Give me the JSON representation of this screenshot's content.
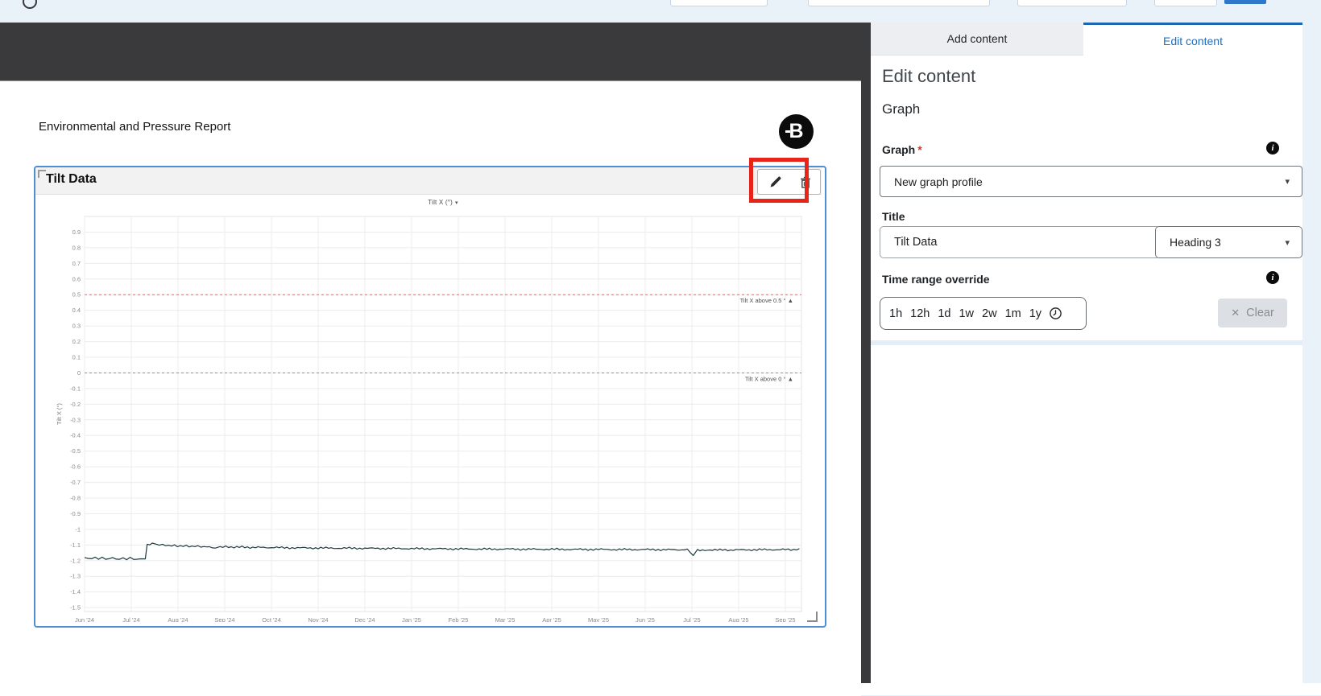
{
  "icons": {
    "info_glyph": "i",
    "caret": "▾",
    "clear_x": "✕",
    "chart_title_caret": "▾"
  },
  "document": {
    "report_title": "Environmental and Pressure Report",
    "logo_letter": "B",
    "graph_block_title": "Tilt Data"
  },
  "side_panel": {
    "tabs": [
      {
        "label": "Add content",
        "active": false
      },
      {
        "label": "Edit content",
        "active": true
      }
    ],
    "heading": "Edit content",
    "section": "Graph",
    "graph_field": {
      "label": "Graph",
      "required_mark": "*",
      "value": "New graph profile"
    },
    "title_field": {
      "label": "Title",
      "value": "Tilt Data",
      "style_value": "Heading 3"
    },
    "time_range": {
      "label": "Time range override",
      "options": [
        "1h",
        "12h",
        "1d",
        "1w",
        "2w",
        "1m",
        "1y"
      ],
      "clear_label": "Clear"
    }
  },
  "chart_data": {
    "type": "line",
    "title": "Tilt X (°)",
    "ylabel": "Tilt X (°)",
    "xlabel": "",
    "grid": true,
    "legend": "none",
    "ylim": [
      -1.525,
      1.0
    ],
    "x_months": [
      0,
      15
    ],
    "x_tick_labels": [
      "Jun '24",
      "Jul '24",
      "Aug '24",
      "Sep '24",
      "Oct '24",
      "Nov '24",
      "Dec '24",
      "Jan '25",
      "Feb '25",
      "Mar '25",
      "Apr '25",
      "May '25",
      "Jun '25",
      "Jul '25",
      "Aug '25",
      "Sep '25"
    ],
    "y_tick_labels": [
      "0.9",
      "0.8",
      "0.7",
      "0.6",
      "0.5",
      "0.4",
      "0.3",
      "0.2",
      "0.1",
      "0",
      "-0.1",
      "-0.2",
      "-0.3",
      "-0.4",
      "-0.5",
      "-0.6",
      "-0.7",
      "-0.8",
      "-0.9",
      "-1",
      "-1.1",
      "-1.2",
      "-1.3",
      "-1.4",
      "-1.5"
    ],
    "thresholds": [
      {
        "value": 0.5,
        "label": "Tilt X above 0.5 ° ▲",
        "color": "#e07070"
      },
      {
        "value": 0.0,
        "label": "Tilt X above 0 ° ▲",
        "color": "#e07070"
      }
    ],
    "series": [
      {
        "name": "Tilt X",
        "color": "#1c393d",
        "points": [
          [
            0.0,
            -1.18
          ],
          [
            0.15,
            -1.186
          ],
          [
            0.3,
            -1.182
          ],
          [
            0.45,
            -1.188
          ],
          [
            0.6,
            -1.184
          ],
          [
            0.75,
            -1.19
          ],
          [
            0.9,
            -1.185
          ],
          [
            1.05,
            -1.188
          ],
          [
            1.2,
            -1.192
          ],
          [
            1.3,
            -1.188
          ],
          [
            1.34,
            -1.095
          ],
          [
            1.45,
            -1.09
          ],
          [
            1.6,
            -1.098
          ],
          [
            1.8,
            -1.103
          ],
          [
            2.05,
            -1.106
          ],
          [
            2.3,
            -1.108
          ],
          [
            2.55,
            -1.11
          ],
          [
            2.8,
            -1.118
          ],
          [
            2.9,
            -1.112
          ],
          [
            3.2,
            -1.113
          ],
          [
            3.6,
            -1.115
          ],
          [
            4.0,
            -1.116
          ],
          [
            4.5,
            -1.118
          ],
          [
            5.0,
            -1.119
          ],
          [
            5.5,
            -1.12
          ],
          [
            6.0,
            -1.121
          ],
          [
            6.5,
            -1.122
          ],
          [
            7.0,
            -1.123
          ],
          [
            7.5,
            -1.124
          ],
          [
            8.0,
            -1.125
          ],
          [
            8.5,
            -1.126
          ],
          [
            9.0,
            -1.126
          ],
          [
            9.5,
            -1.127
          ],
          [
            10.0,
            -1.127
          ],
          [
            10.5,
            -1.128
          ],
          [
            11.0,
            -1.128
          ],
          [
            11.5,
            -1.129
          ],
          [
            12.0,
            -1.129
          ],
          [
            12.5,
            -1.13
          ],
          [
            12.9,
            -1.13
          ],
          [
            13.03,
            -1.165
          ],
          [
            13.12,
            -1.131
          ],
          [
            13.6,
            -1.132
          ],
          [
            14.0,
            -1.131
          ],
          [
            14.5,
            -1.13
          ],
          [
            15.0,
            -1.129
          ],
          [
            15.3,
            -1.129
          ]
        ]
      }
    ]
  }
}
